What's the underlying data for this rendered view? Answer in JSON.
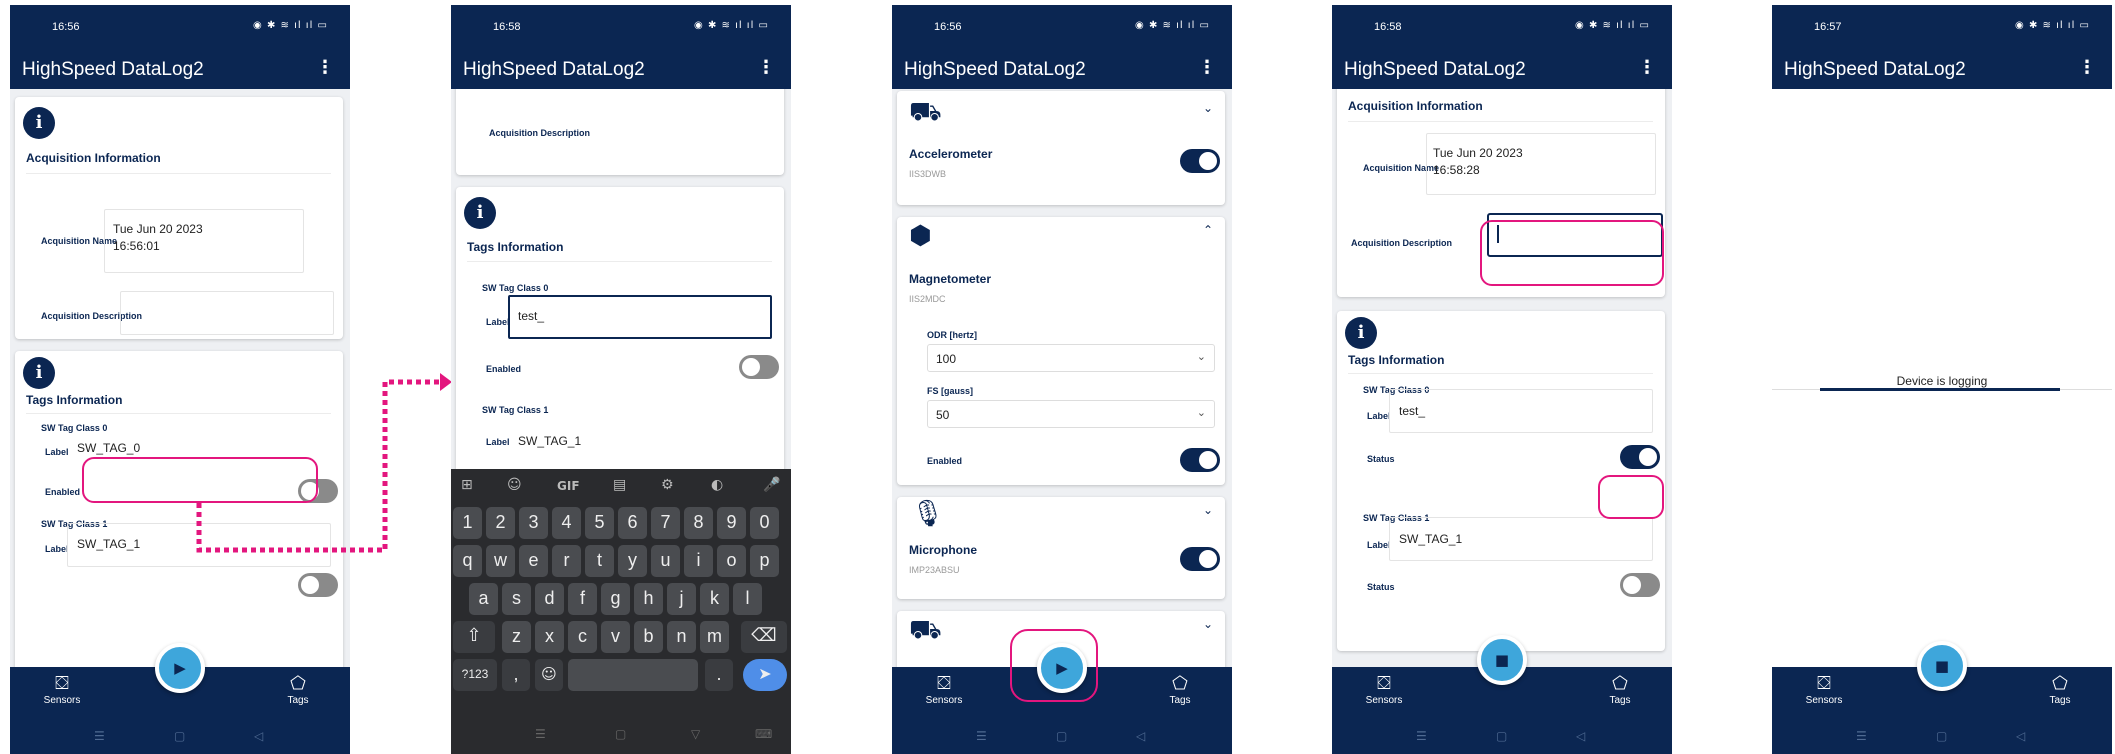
{
  "app_title": "HighSpeed DataLog2",
  "status_icons": "◉ ✱ ≋ ıl ıl ▭",
  "nav": {
    "sensors": "Sensors",
    "tags": "Tags"
  },
  "sysnav": {
    "recents": "☰",
    "home": "▢",
    "back": "◁"
  },
  "screens": [
    {
      "time": "16:56",
      "acq_title": "Acquisition Information",
      "acq_name_label": "Acquisition Name",
      "acq_name_value": "Tue Jun 20 2023\n16:56:01",
      "acq_desc_label": "Acquisition Description",
      "tags_title": "Tags Information",
      "class0": "SW Tag Class 0",
      "label_word": "Label",
      "class0_value": "SW_TAG_0",
      "enabled": "Enabled",
      "class1": "SW Tag Class 1",
      "class1_value": "SW_TAG_1",
      "fab": "▶"
    },
    {
      "time": "16:58",
      "acq_desc_label": "Acquisition Description",
      "tags_title": "Tags Information",
      "class0": "SW Tag Class 0",
      "label_word": "Label",
      "class0_value": "test_",
      "enabled": "Enabled",
      "class1": "SW Tag Class 1",
      "class1_value": "SW_TAG_1",
      "kb_tools": [
        "⊞",
        "☺",
        "GIF",
        "▤",
        "⚙",
        "◐",
        "🎤"
      ],
      "kb_row1": [
        "1",
        "2",
        "3",
        "4",
        "5",
        "6",
        "7",
        "8",
        "9",
        "0"
      ],
      "kb_row2": [
        "q",
        "w",
        "e",
        "r",
        "t",
        "y",
        "u",
        "i",
        "o",
        "p"
      ],
      "kb_row3": [
        "a",
        "s",
        "d",
        "f",
        "g",
        "h",
        "j",
        "k",
        "l"
      ],
      "kb_row4": [
        "⇧",
        "z",
        "x",
        "c",
        "v",
        "b",
        "n",
        "m",
        "⌫"
      ],
      "kb_sym": "?123",
      "kb_comma": ",",
      "kb_emoji": "☺",
      "kb_period": ".",
      "kb_enter": "➤",
      "kb_nav": [
        "☰",
        "▢",
        "▽",
        "⌨"
      ]
    },
    {
      "time": "16:56",
      "accel_name": "Accelerometer",
      "accel_part": "IIS3DWB",
      "mag_name": "Magnetometer",
      "mag_part": "IIS2MDC",
      "odr_label": "ODR [hertz]",
      "odr_value": "100",
      "fs_label": "FS [gauss]",
      "fs_value": "50",
      "enabled": "Enabled",
      "mic_name": "Microphone",
      "mic_part": "IMP23ABSU",
      "fab": "▶"
    },
    {
      "time": "16:58",
      "acq_title": "Acquisition Information",
      "acq_name_label": "Acquisition Name",
      "acq_name_value": "Tue Jun 20 2023\n16:58:28",
      "acq_desc_label": "Acquisition Description",
      "tags_title": "Tags Information",
      "class0": "SW Tag Class 0",
      "label_word": "Label",
      "class0_value": "test_",
      "status": "Status",
      "class1": "SW Tag Class 1",
      "class1_value": "SW_TAG_1",
      "fab": "■"
    },
    {
      "time": "16:57",
      "logging_text": "Device is logging",
      "fab": "■"
    }
  ],
  "colors": {
    "primary": "#0b2652",
    "accent": "#3ea6db",
    "highlight": "#e3167e"
  }
}
